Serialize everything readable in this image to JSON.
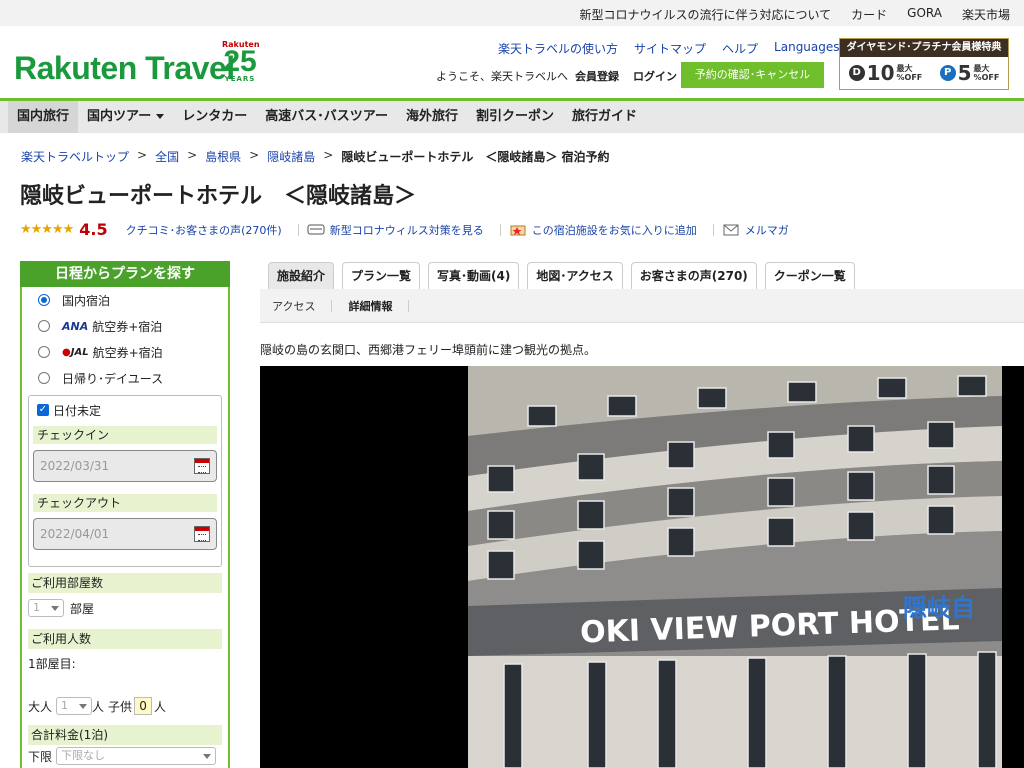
{
  "topbar": {
    "links": [
      "新型コロナウイルスの流行に伴う対応について",
      "カード",
      "GORA",
      "楽天市場"
    ]
  },
  "header": {
    "logo_text": "Rakuten Travel",
    "logo25_top": "Rakuten",
    "logo25_num": "25",
    "logo25_years": "YEARS",
    "links": [
      "楽天トラベルの使い方",
      "サイトマップ",
      "ヘルプ",
      "Languages"
    ],
    "welcome": "ようこそ、楽天トラベルへ",
    "member_register": "会員登録",
    "login": "ログイン",
    "reserve_button": "予約の確認･キャンセル",
    "diamond_banner": {
      "title": "ダイヤモンド･プラチナ会員様特典",
      "d_pct": "10",
      "p_pct": "5",
      "small_top": "最大",
      "small_bottom": "%OFF"
    }
  },
  "nav": {
    "items": [
      "国内旅行",
      "国内ツアー",
      "レンタカー",
      "高速バス･バスツアー",
      "海外旅行",
      "割引クーポン",
      "旅行ガイド"
    ]
  },
  "breadcrumb": {
    "items": [
      "楽天トラベルトップ",
      "全国",
      "島根県",
      "隠岐諸島"
    ],
    "current": "隠岐ビューポートホテル　＜隠岐諸島＞ 宿泊予約",
    "sep": ">"
  },
  "hotel": {
    "title": "隠岐ビューポートホテル　＜隠岐諸島＞",
    "stars": "★★★★★",
    "score": "4.5",
    "reviews_link": "クチコミ･お客さまの声(270件)",
    "covid_link": "新型コロナウィルス対策を見る",
    "fav_link": "この宿泊施設をお気に入りに追加",
    "mail_link": "メルマガ",
    "description": "隠岐の島の玄関口、西郷港フェリー埠頭前に建つ観光の拠点。",
    "photo_sign": "OKI VIEW PORT HOTEL",
    "photo_sign_jp": "隠岐自"
  },
  "sidebar": {
    "title": "日程からプランを探す",
    "options": [
      "国内宿泊",
      "航空券+宿泊",
      "航空券+宿泊",
      "日帰り･デイユース"
    ],
    "ana_label": "ANA",
    "jal_label": "JAL",
    "date_undecided": "日付未定",
    "checkin_label": "チェックイン",
    "checkin_value": "2022/03/31",
    "checkout_label": "チェックアウト",
    "checkout_value": "2022/04/01",
    "rooms_label": "ご利用部屋数",
    "rooms_value": "1",
    "rooms_unit": "部屋",
    "guests_label": "ご利用人数",
    "room1_label": "1部屋目:",
    "adult_label": "大人",
    "adult_value": "1",
    "person_unit": "人",
    "child_label": "子供",
    "child_value": "0",
    "price_label": "合計料金(1泊)",
    "min_label": "下限",
    "min_value": "下限なし"
  },
  "tabs": {
    "items": [
      "施設紹介",
      "プラン一覧",
      "写真･動画(4)",
      "地図･アクセス",
      "お客さまの声(270)",
      "クーポン一覧"
    ],
    "sub": [
      "アクセス",
      "詳細情報"
    ]
  }
}
